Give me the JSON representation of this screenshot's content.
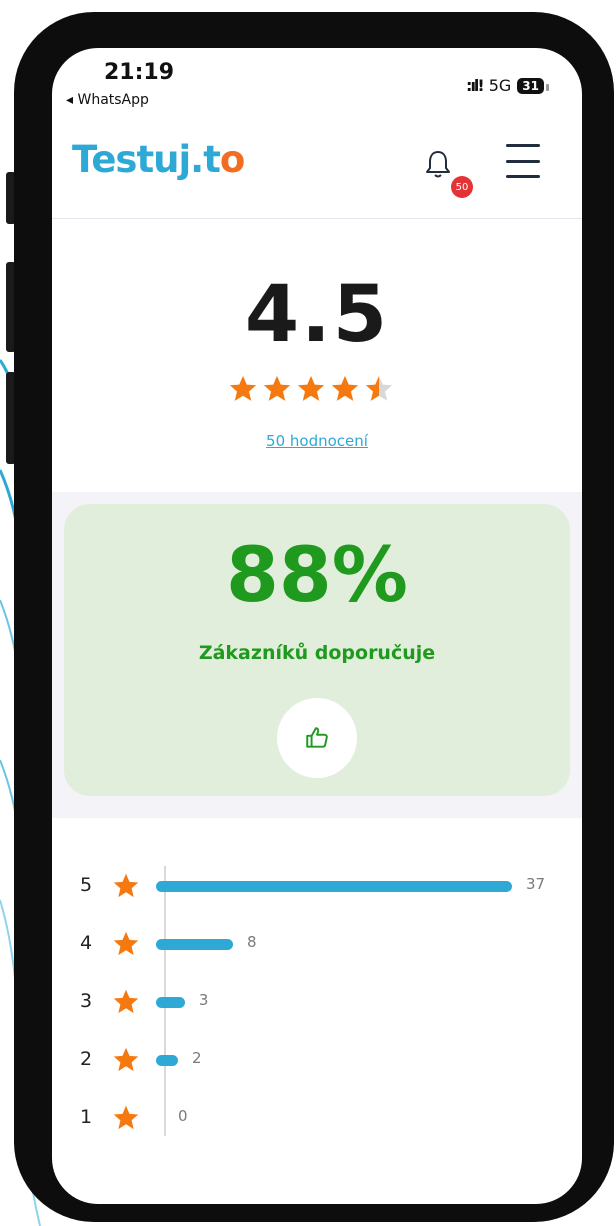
{
  "status_bar": {
    "time": "21:19",
    "back_app": "◂ WhatsApp",
    "network": "5G",
    "battery": "31"
  },
  "header": {
    "logo_text": "Testuj.t",
    "logo_check": "o",
    "notification_count": "50"
  },
  "rating": {
    "value": "4.5",
    "stars": 4.5,
    "reviews_link": "50 hodnocení"
  },
  "recommend": {
    "percent": "88%",
    "label": "Zákazníků doporučuje",
    "icon": "thumbs-up-icon"
  },
  "distribution": {
    "rows": [
      {
        "stars": "5",
        "count": "37"
      },
      {
        "stars": "4",
        "count": "8"
      },
      {
        "stars": "3",
        "count": "3"
      },
      {
        "stars": "2",
        "count": "2"
      },
      {
        "stars": "1",
        "count": "0"
      }
    ],
    "max": 37
  },
  "colors": {
    "brand": "#2ea9d6",
    "accent": "#f26c22",
    "recommend_green": "#1f9a1e",
    "star": "#f5790f",
    "badge": "#e43335"
  }
}
